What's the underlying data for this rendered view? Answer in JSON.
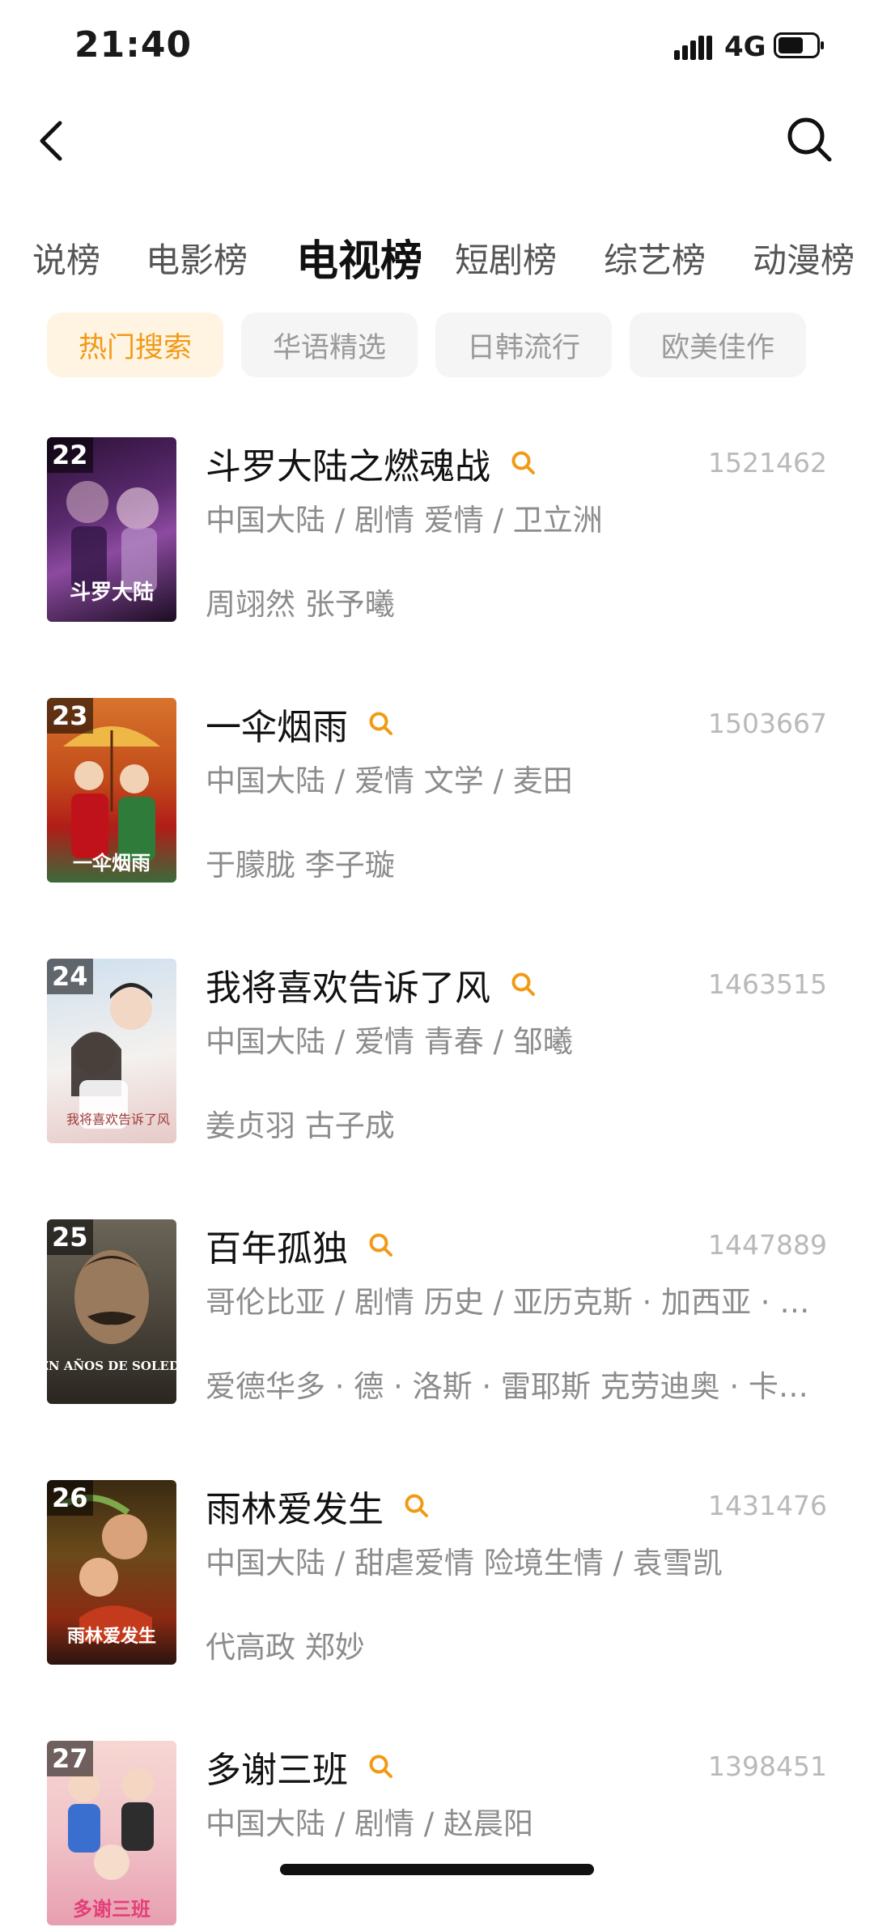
{
  "status": {
    "time": "21:40",
    "network": "4G"
  },
  "nav": {
    "back_icon": "chevron-left-icon",
    "search_icon": "search-icon"
  },
  "tabs": [
    "说榜",
    "电影榜",
    "电视榜",
    "短剧榜",
    "综艺榜",
    "动漫榜"
  ],
  "active_tab": "电视榜",
  "chips": [
    "热门搜索",
    "华语精选",
    "日韩流行",
    "欧美佳作"
  ],
  "active_chip": "热门搜索",
  "accent_color": "#f19a16",
  "items": [
    {
      "rank": "22",
      "title": "斗罗大陆之燃魂战",
      "hot": "1521462",
      "meta": "中国大陆 / 剧情 爱情 / 卫立洲",
      "cast": "周翊然 张予曦",
      "poster_text": "斗罗大陆"
    },
    {
      "rank": "23",
      "title": "一伞烟雨",
      "hot": "1503667",
      "meta": "中国大陆 / 爱情 文学 / 麦田",
      "cast": "于朦胧 李子璇",
      "poster_text": "一伞烟雨"
    },
    {
      "rank": "24",
      "title": "我将喜欢告诉了风",
      "hot": "1463515",
      "meta": "中国大陆 / 爱情 青春 / 邹曦",
      "cast": "姜贞羽 古子成",
      "poster_text": "我将喜欢告诉了风"
    },
    {
      "rank": "25",
      "title": "百年孤独",
      "hot": "1447889",
      "meta": "哥伦比亚 / 剧情 历史 / 亚历克斯 · 加西亚 · 洛佩斯",
      "cast": "爱德华多 · 德 · 洛斯 · 雷耶斯 克劳迪奥 · 卡塔诺",
      "poster_text": "CIEN AÑOS DE SOLEDAD"
    },
    {
      "rank": "26",
      "title": "雨林爱发生",
      "hot": "1431476",
      "meta": "中国大陆 / 甜虐爱情 险境生情 / 袁雪凯",
      "cast": "代高政 郑妙",
      "poster_text": "雨林爱发生"
    },
    {
      "rank": "27",
      "title": "多谢三班",
      "hot": "1398451",
      "meta": "中国大陆 / 剧情 / 赵晨阳",
      "cast": "",
      "poster_text": "多谢三班"
    }
  ]
}
